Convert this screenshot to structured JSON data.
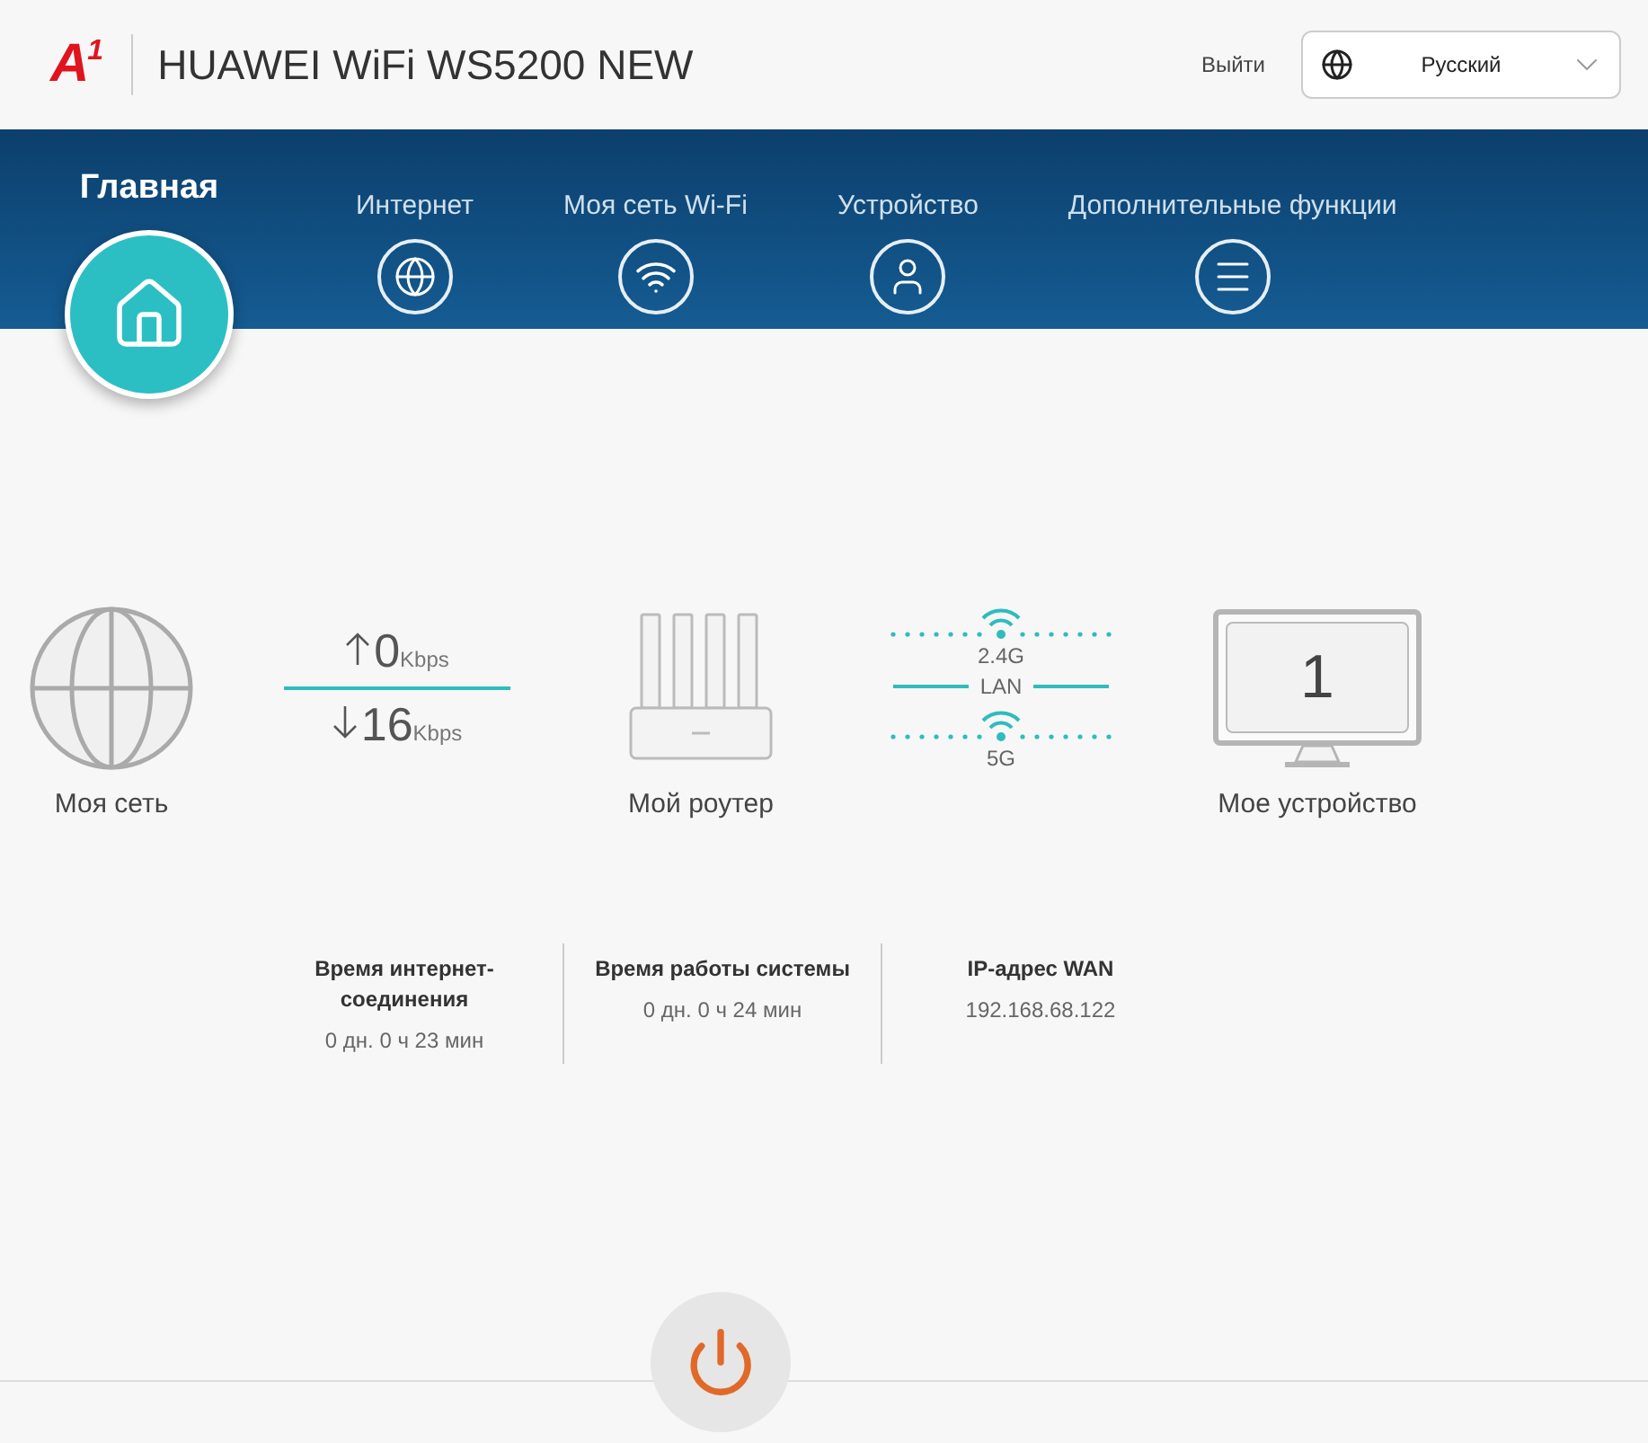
{
  "header": {
    "logo": {
      "letter": "A",
      "sup": "1"
    },
    "title": "HUAWEI WiFi WS5200 NEW",
    "logout": "Выйти",
    "language": "Русский"
  },
  "tabs": [
    {
      "label": "Главная",
      "kind": "home",
      "selected": true
    },
    {
      "label": "Интернет",
      "kind": "internet",
      "selected": false
    },
    {
      "label": "Моя сеть Wi-Fi",
      "kind": "wifi",
      "selected": false
    },
    {
      "label": "Устройство",
      "kind": "device",
      "selected": false
    },
    {
      "label": "Дополнительные функции",
      "kind": "more",
      "selected": false
    }
  ],
  "diagram": [
    {
      "kind": "network",
      "label": "Моя сеть"
    },
    {
      "kind": "speed",
      "up": "0",
      "up_unit": "Kbps",
      "down": "16",
      "down_unit": "Kbps"
    },
    {
      "kind": "router",
      "label": "Мой роутер"
    },
    {
      "kind": "bands",
      "band_1": "2.4G",
      "wired": "LAN",
      "band_2": "5G"
    },
    {
      "kind": "device",
      "count": "1",
      "label": "Мое устройство"
    }
  ],
  "stats": [
    {
      "title": "Время интернет-соединения",
      "value": "0 дн. 0 ч 23 мин"
    },
    {
      "title": "Время работы системы",
      "value": "0 дн. 0 ч 24 мин"
    },
    {
      "title": "IP-адрес WAN",
      "value": "192.168.68.122"
    }
  ]
}
